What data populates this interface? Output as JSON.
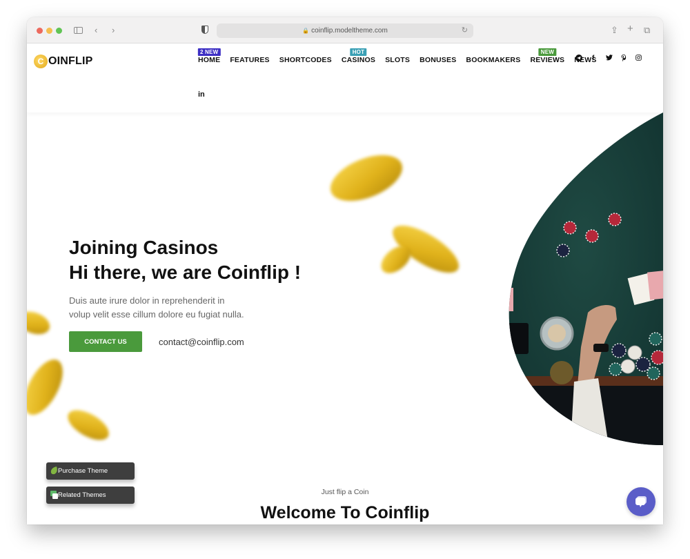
{
  "browser": {
    "url": "coinflip.modeltheme.com"
  },
  "site": {
    "logo_letter": "C",
    "logo_text": "OINFLIP",
    "nav": [
      {
        "label": "HOME",
        "badge": "2 NEW",
        "badge_color": "#3d2fc4"
      },
      {
        "label": "FEATURES"
      },
      {
        "label": "SHORTCODES"
      },
      {
        "label": "CASINOS",
        "badge": "HOT",
        "badge_color": "#3aa0b5"
      },
      {
        "label": "SLOTS"
      },
      {
        "label": "BONUSES"
      },
      {
        "label": "BOOKMAKERS"
      },
      {
        "label": "REVIEWS",
        "badge": "NEW",
        "badge_color": "#4a9a3c"
      },
      {
        "label": "NEWS"
      }
    ],
    "social": {
      "telegram": "➤",
      "facebook": "f",
      "twitter": "🐦",
      "pinterest": "℗",
      "instagram": "◎",
      "linkedin": "in"
    }
  },
  "hero": {
    "title_line1": "Joining Casinos",
    "title_line2": "Hi there, we are Coinflip !",
    "desc_line1": "Duis aute irure dolor in reprehenderit in",
    "desc_line2": "volup velit esse cillum dolore eu fugiat nulla.",
    "contact_button": "CONTACT US",
    "email": "contact@coinflip.com"
  },
  "floating": {
    "purchase": "Purchase Theme",
    "related": "Related Themes"
  },
  "welcome": {
    "subtitle": "Just flip a Coin",
    "title": "Welcome To Coinflip"
  },
  "colors": {
    "accent_green": "#4a9a3c",
    "chat_purple": "#5a5dc8"
  }
}
